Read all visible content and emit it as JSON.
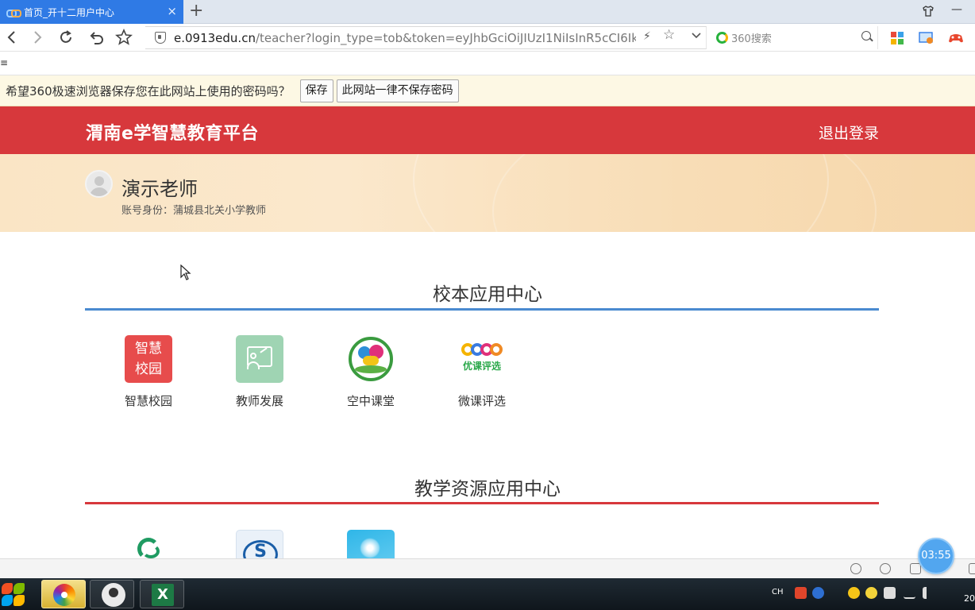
{
  "browser": {
    "tab_title": "首页_开十二用户中心",
    "tab_close": "×",
    "new_tab": "+",
    "url_host": "e.0913edu.cn",
    "url_path": "/teacher?login_type=tob&token=eyJhbGciOiJIUzI1NiIsInR5cCI6Ikp",
    "search_placeholder": "360搜索",
    "bookmark_menu_glyph": "≡"
  },
  "infobar": {
    "message": "希望360极速浏览器保存您在此网站上使用的密码吗？",
    "save_label": "保存",
    "never_label": "此网站一律不保存密码"
  },
  "site": {
    "title": "渭南e学智慧教育平台",
    "logout": "退出登录"
  },
  "profile": {
    "name": "演示老师",
    "identity": "账号身份：蒲城县北关小学教师"
  },
  "sections": [
    {
      "title": "校本应用中心",
      "line_color": "#4a8ad0",
      "apps": [
        {
          "label": "智慧校园",
          "icon": "smart-campus-icon",
          "icon_text_1": "智慧",
          "icon_text_2": "校园"
        },
        {
          "label": "教师发展",
          "icon": "teacher-development-icon"
        },
        {
          "label": "空中课堂",
          "icon": "air-classroom-icon"
        },
        {
          "label": "微课评选",
          "icon": "micro-course-icon",
          "icon_text_1": "优课评选"
        }
      ]
    },
    {
      "title": "教学资源应用中心",
      "line_color": "#d7383c",
      "apps": [
        {
          "icon": "resource-swirl-icon"
        },
        {
          "icon": "resource-cloud-icon",
          "icon_text_1": "S"
        },
        {
          "icon": "resource-dandelion-icon"
        }
      ]
    }
  ],
  "timer": "03:55",
  "taskbar": {
    "lang": "CH",
    "excel_letter": "X",
    "clock_fragment": "20"
  },
  "colors": {
    "header_red": "#d7383c",
    "tab_blue": "#2f7ae5",
    "infobar_bg": "#fdf8e4"
  }
}
